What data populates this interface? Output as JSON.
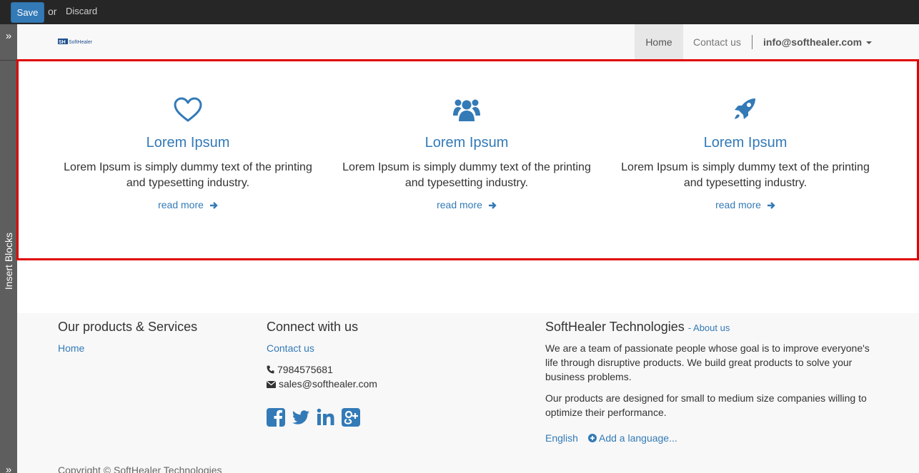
{
  "editor": {
    "save_label": "Save",
    "or_label": "or",
    "discard_label": "Discard",
    "insert_blocks_label": "Insert Blocks"
  },
  "navbar": {
    "logo_text": "SoftHealer",
    "items": [
      {
        "label": "Home",
        "active": true
      },
      {
        "label": "Contact us",
        "active": false
      }
    ],
    "user_menu": "info@softhealer.com"
  },
  "features": [
    {
      "icon": "heart-icon",
      "title": "Lorem Ipsum",
      "text": "Lorem Ipsum is simply dummy text of the printing and typesetting industry.",
      "link": "read more"
    },
    {
      "icon": "users-icon",
      "title": "Lorem Ipsum",
      "text": "Lorem Ipsum is simply dummy text of the printing and typesetting industry.",
      "link": "read more"
    },
    {
      "icon": "rocket-icon",
      "title": "Lorem Ipsum",
      "text": "Lorem Ipsum is simply dummy text of the printing and typesetting industry.",
      "link": "read more"
    }
  ],
  "footer": {
    "products": {
      "heading": "Our products & Services",
      "links": [
        "Home"
      ]
    },
    "connect": {
      "heading": "Connect with us",
      "contact_link": "Contact us",
      "phone": "7984575681",
      "email": "sales@softhealer.com",
      "social": [
        "facebook-icon",
        "twitter-icon",
        "linkedin-icon",
        "google-plus-icon"
      ]
    },
    "company": {
      "heading": "SoftHealer Technologies",
      "about_link": "- About us",
      "para1": "We are a team of passionate people whose goal is to improve everyone's life through disruptive products. We build great products to solve your business problems.",
      "para2": "Our products are designed for small to medium size companies willing to optimize their performance.",
      "language": "English",
      "add_language": "Add a language..."
    },
    "copyright": "Copyright © SoftHealer Technologies"
  },
  "colors": {
    "accent": "#337ab7",
    "editbar": "#262626",
    "highlight_border": "#e00000",
    "rail": "#5e5e5e"
  }
}
